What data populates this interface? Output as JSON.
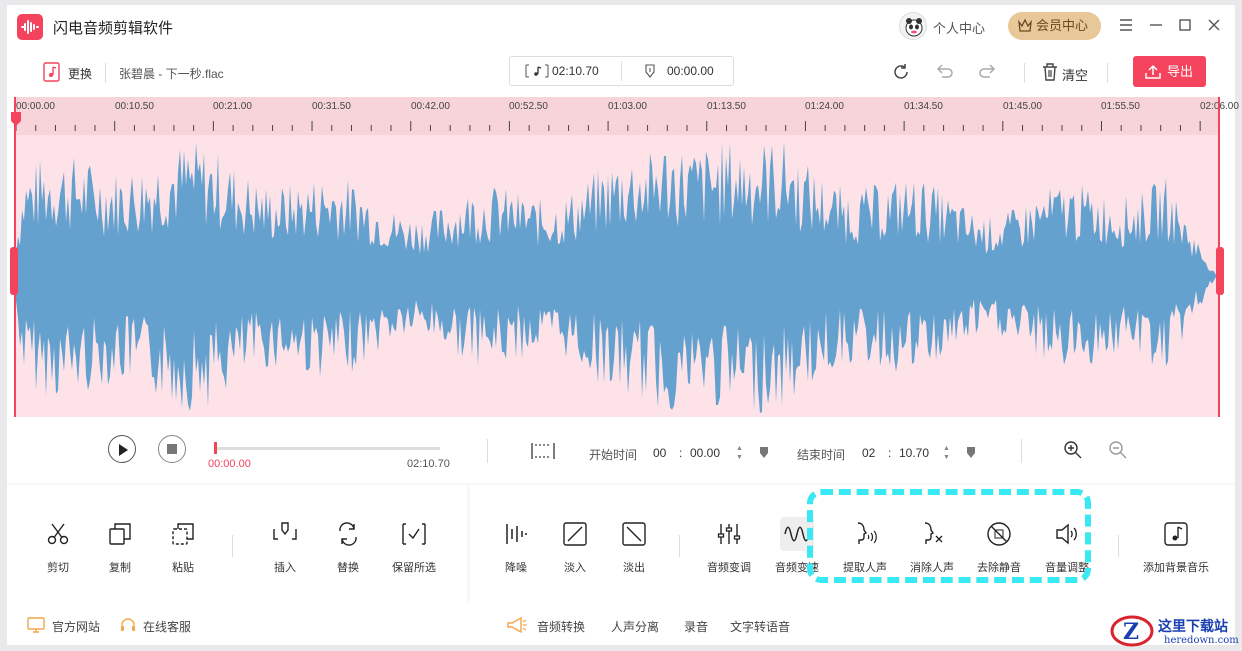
{
  "window": {
    "title": "闪电音频剪辑软件",
    "personal_center": "个人中心",
    "vip_center": "会员中心"
  },
  "toolbar": {
    "replace_label": "更换",
    "filename": "张碧晨 - 下一秒.flac",
    "duration": "02:10.70",
    "position": "00:00.00",
    "clear_label": "清空",
    "export_label": "导出"
  },
  "ruler": {
    "labels": [
      "00:00.00",
      "00:10.50",
      "00:21.00",
      "00:31.50",
      "00:42.00",
      "00:52.50",
      "01:03.00",
      "01:13.50",
      "01:24.00",
      "01:34.50",
      "01:45.00",
      "01:55.50",
      "02:06.00"
    ]
  },
  "playback": {
    "current_time": "00:00.00",
    "total_time": "02:10.70",
    "progress": 0.0,
    "start_label": "开始时间",
    "start_min": "00",
    "start_sec": "00.00",
    "end_label": "结束时间",
    "end_min": "02",
    "end_sec": "10.70",
    "colon": ":"
  },
  "tools": {
    "cut": "剪切",
    "copy": "复制",
    "paste": "粘贴",
    "insert": "插入",
    "replace": "替换",
    "keep_selected": "保留所选",
    "denoise": "降噪",
    "fade_in": "淡入",
    "fade_out": "淡出",
    "pitch": "音频变调",
    "speed": "音频变速",
    "extract_vocal": "提取人声",
    "remove_vocal": "消除人声",
    "remove_silence": "去除静音",
    "volume": "音量调整",
    "add_bgm": "添加背景音乐"
  },
  "footer": {
    "official_site": "官方网站",
    "online_service": "在线客服",
    "audio_convert": "音频转换",
    "vocal_separation": "人声分离",
    "record": "录音",
    "tts": "文字转语音"
  },
  "watermark": {
    "name": "这里下载站",
    "url": "heredown.com"
  },
  "colors": {
    "accent": "#f4435c",
    "waveform": "#64a1cf",
    "wave_bg": "#fde3e8",
    "highlight": "#38e8f2",
    "vip": "#e8c898"
  }
}
